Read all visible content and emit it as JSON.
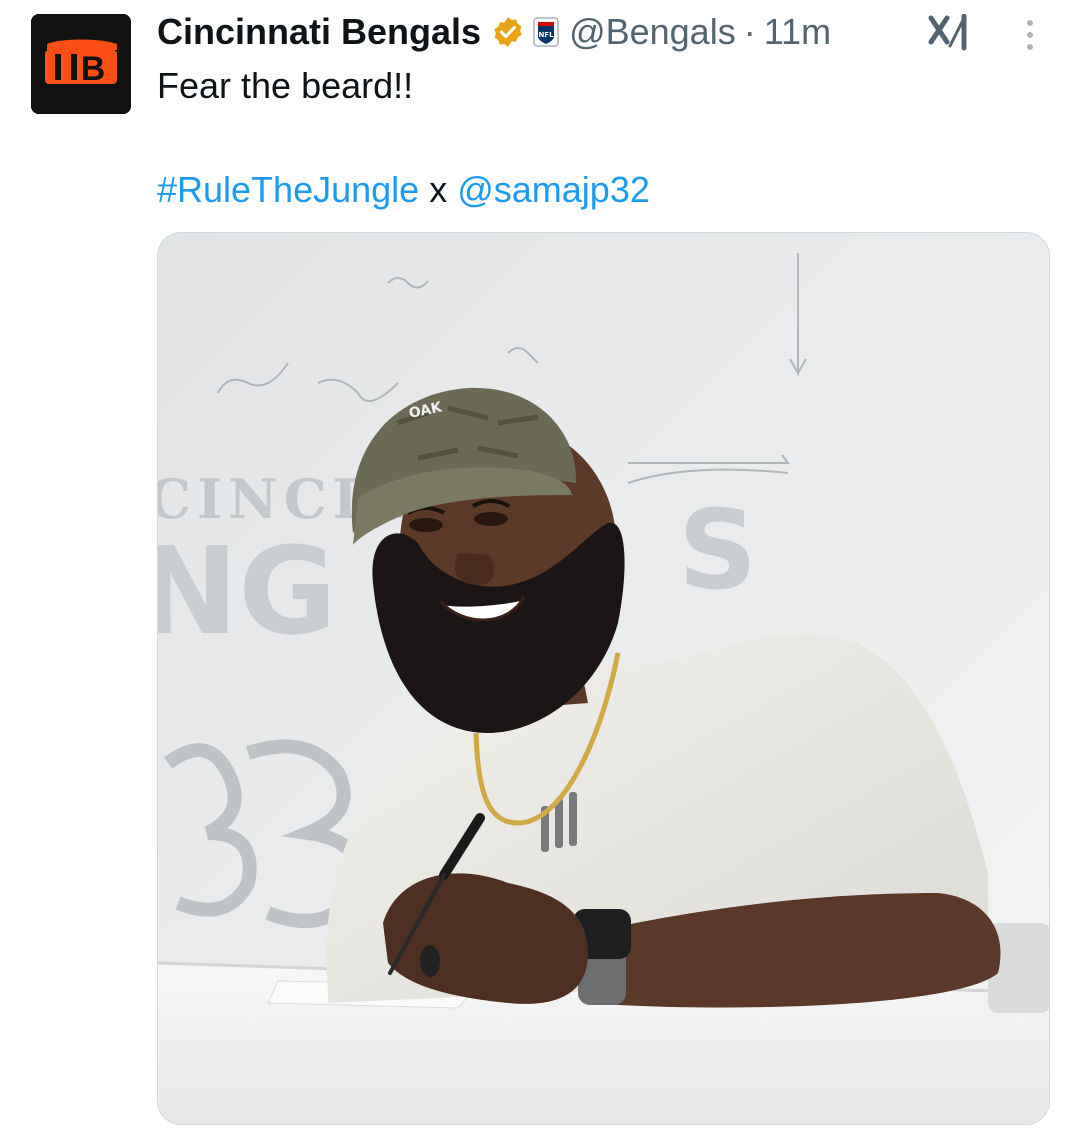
{
  "tweet": {
    "author_name": "Cincinnati Bengals",
    "handle": "@Bengals",
    "separator": "·",
    "time": "11m",
    "text": "Fear the beard!!",
    "hashtag": "#RuleTheJungle",
    "connector": "x",
    "mention": "@samajp32",
    "avatar_text": "B"
  },
  "icons": {
    "verified": "verified-gold-badge-icon",
    "affiliate": "nfl-affiliate-badge-icon",
    "grok": "grok-icon",
    "more": "more-vertical-icon"
  },
  "media": {
    "wall_text_top": "CINCINN",
    "wall_text_bottom": "NG",
    "wall_text_right": "S",
    "cap_text": "OAK"
  },
  "colors": {
    "link": "#1d9bf0",
    "text": "#0f1419",
    "muted": "#536471",
    "verified_gold": "#e8a317",
    "bengals_orange": "#fb4f14"
  }
}
